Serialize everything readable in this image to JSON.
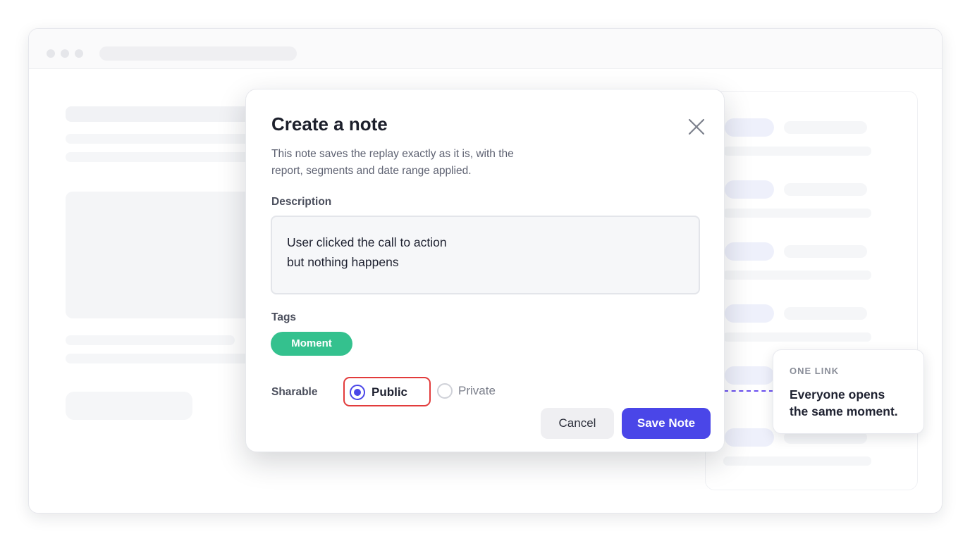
{
  "modal": {
    "title": "Create a note",
    "intro_line1": "This note saves the replay exactly as it is, with the",
    "intro_line2": "report, segments and date range applied.",
    "description_label": "Description",
    "description_line1": "User clicked the call to action",
    "description_line2": "but nothing happens",
    "tags_label": "Tags",
    "tag": "Moment",
    "sharable_label": "Sharable",
    "options": [
      {
        "label": "Public",
        "selected": true
      },
      {
        "label": "Private",
        "selected": false
      }
    ],
    "cancel_label": "Cancel",
    "save_label": "Save Note"
  },
  "callout": {
    "eyebrow": "ONE LINK",
    "line1": "Everyone opens",
    "line2": "the same moment."
  },
  "colors": {
    "accent": "#4a46e8",
    "tag": "#34c18e",
    "highlight": "#e23b3b",
    "dashed_connector": "#6a4ff0"
  }
}
